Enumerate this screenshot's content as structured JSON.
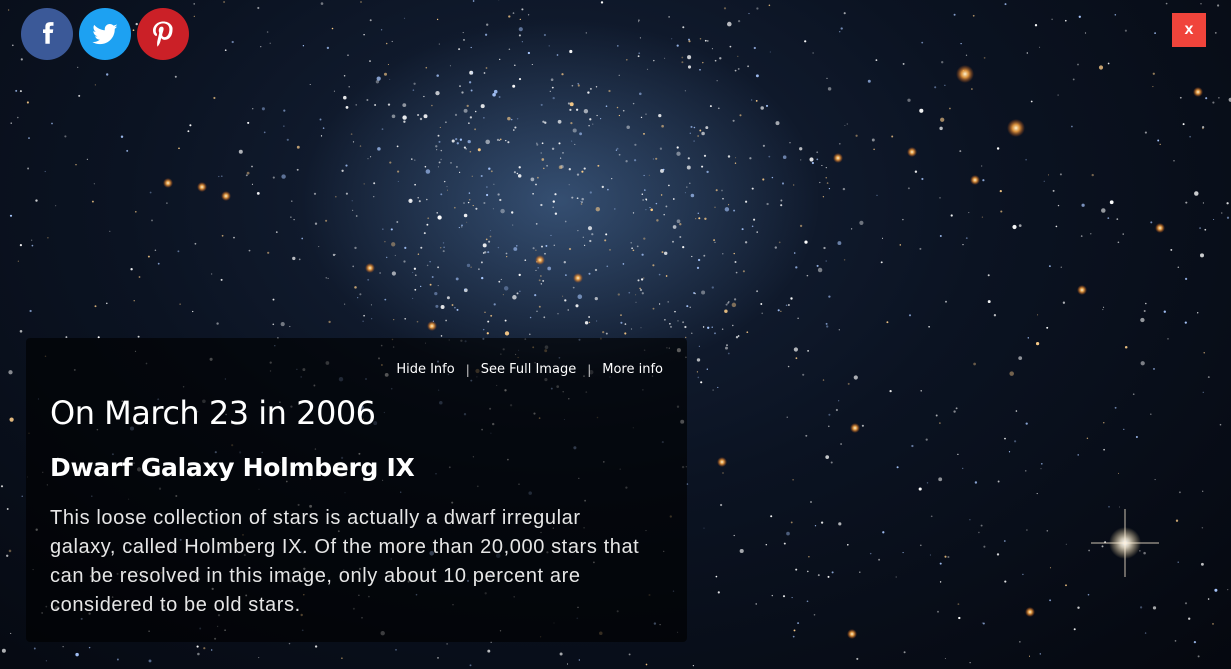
{
  "social": {
    "facebook": {
      "icon": "facebook-icon",
      "color": "#3b5998"
    },
    "twitter": {
      "icon": "twitter-icon",
      "color": "#1da1f2"
    },
    "pinterest": {
      "icon": "pinterest-icon",
      "color": "#cb2027"
    }
  },
  "close": {
    "label": "x",
    "color": "#f0443b"
  },
  "info": {
    "nav": {
      "hide_info": "Hide Info",
      "separator": "|",
      "full_image": "See Full Image",
      "more_info": "More info"
    },
    "date": "On March 23 in 2006",
    "title": "Dwarf Galaxy Holmberg IX",
    "description": "This loose collection of stars is actually a dwarf irregular galaxy, called Holmberg IX. Of the more than 20,000 stars that can be resolved in this image, only about 10 percent are considered to be old stars."
  },
  "background": {
    "icon": "starfield-image"
  }
}
